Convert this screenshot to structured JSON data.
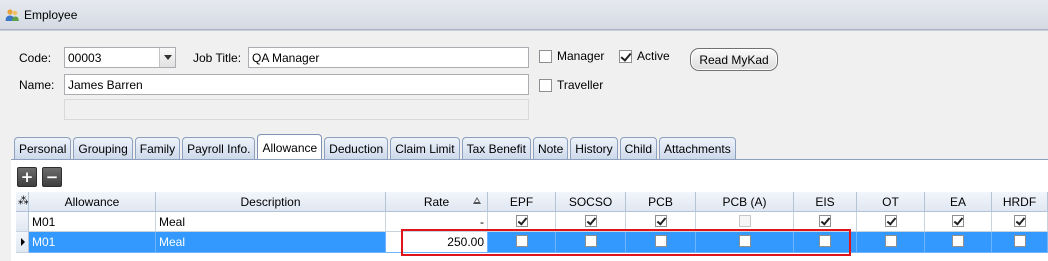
{
  "window": {
    "title": "Employee"
  },
  "form": {
    "code_label": "Code:",
    "code_value": "00003",
    "job_title_label": "Job Title:",
    "job_title_value": "QA Manager",
    "name_label": "Name:",
    "name_value": "James Barren",
    "manager_label": "Manager",
    "manager_checked": false,
    "active_label": "Active",
    "active_checked": true,
    "traveller_label": "Traveller",
    "traveller_checked": false,
    "read_mykad_label": "Read MyKad"
  },
  "tabs": [
    {
      "label": "Personal",
      "active": false
    },
    {
      "label": "Grouping",
      "active": false
    },
    {
      "label": "Family",
      "active": false
    },
    {
      "label": "Payroll Info.",
      "active": false
    },
    {
      "label": "Allowance",
      "active": true
    },
    {
      "label": "Deduction",
      "active": false
    },
    {
      "label": "Claim Limit",
      "active": false
    },
    {
      "label": "Tax Benefit",
      "active": false
    },
    {
      "label": "Note",
      "active": false
    },
    {
      "label": "History",
      "active": false
    },
    {
      "label": "Child",
      "active": false
    },
    {
      "label": "Attachments",
      "active": false
    }
  ],
  "toolbar": {
    "add_icon": "plus-icon",
    "remove_icon": "minus-icon"
  },
  "grid": {
    "columns": [
      "Allowance",
      "Description",
      "Rate",
      "EPF",
      "SOCSO",
      "PCB",
      "PCB (A)",
      "EIS",
      "OT",
      "EA",
      "HRDF"
    ],
    "sorted_column": "Rate",
    "rows": [
      {
        "allowance": "M01",
        "description": "Meal",
        "rate": "-",
        "epf": true,
        "socso": true,
        "pcb": true,
        "pcb_a": false,
        "eis": true,
        "ot": true,
        "ea": true,
        "hrdf": true,
        "selected": false
      },
      {
        "allowance": "M01",
        "description": "Meal",
        "rate": "250.00",
        "epf": false,
        "socso": false,
        "pcb": false,
        "pcb_a": false,
        "eis": false,
        "ot": false,
        "ea": false,
        "hrdf": false,
        "selected": true
      }
    ]
  },
  "colors": {
    "selection": "#3399ff",
    "highlight_border": "#e0141b"
  }
}
